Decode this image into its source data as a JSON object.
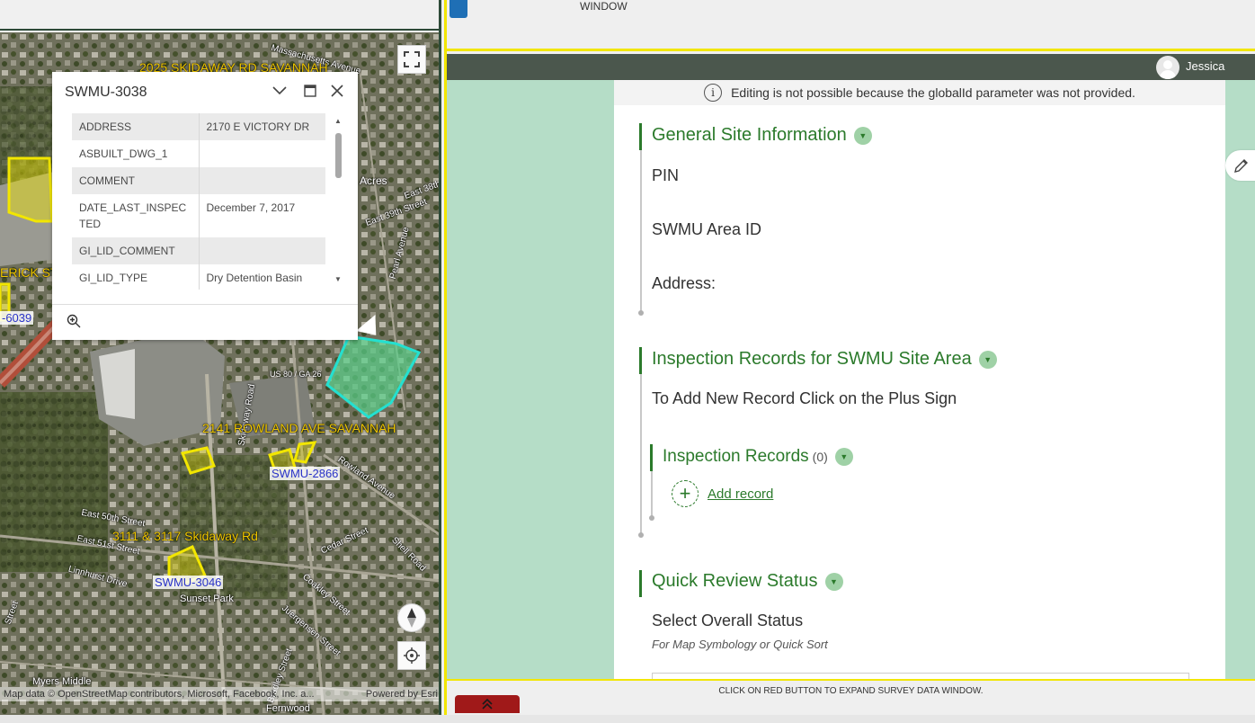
{
  "map": {
    "road_labels": [
      "Massachusetts Avenue",
      "Acres",
      "East 38th",
      "East 39th Street",
      "Pearl Avenue",
      "Rowland Avenue",
      "Skidaway Road",
      "East 50th Street",
      "East 51st Street",
      "Linnhurst Drive",
      "Cedar Street",
      "Shell Road",
      "Coakley Street",
      "Juergensen Street",
      "Bradley Street",
      "Street",
      "US 80 / GA 26"
    ],
    "address_labels": [
      "2025 SKIDAWAY RD SAVANNAH",
      "ERICK ST",
      "2141 ROWLAND AVE SAVANNAH",
      "3111 & 3117 Skidaway Rd"
    ],
    "swmu_labels": [
      "SWMU-2866",
      "SWMU-3046",
      "-6039"
    ],
    "place_labels": [
      "Sunset Park",
      "Myers Middle",
      "Fernwood"
    ],
    "attribution": "Map data © OpenStreetMap contributors, Microsoft, Facebook, Inc. a...",
    "powered_by": "Powered by Esri",
    "colors": {
      "parcel_yellow": "#f2e600",
      "selected_cyan": "#24e0d0",
      "frame": "#2d4a38"
    },
    "icons": {
      "fullscreen": "expand-icon",
      "compass": "compass-icon",
      "locate": "locate-icon"
    }
  },
  "popup": {
    "title": "SWMU-3038",
    "fields": [
      {
        "name": "ADDRESS",
        "value": "2170 E VICTORY DR"
      },
      {
        "name": "ASBUILT_DWG_1",
        "value": ""
      },
      {
        "name": "COMMENT",
        "value": ""
      },
      {
        "name": "DATE_LAST_INSPECTED",
        "value": "December 7, 2017"
      },
      {
        "name": "GI_LID_COMMENT",
        "value": ""
      },
      {
        "name": "GI_LID_TYPE",
        "value": "Dry Detention Basin"
      }
    ],
    "icons": {
      "collapse": "chevron-down-icon",
      "dock": "dock-icon",
      "close": "close-icon",
      "zoom": "zoom-to-icon"
    }
  },
  "app": {
    "window_label": "WINDOW",
    "user_name": "Jessica",
    "expand_hint": "CLICK ON RED BUTTON TO EXPAND SURVEY DATA WINDOW."
  },
  "survey": {
    "notice": "Editing is not possible because the globalId parameter was not provided.",
    "groups": {
      "general": {
        "title": "General Site Information",
        "fields": [
          "PIN",
          "SWMU Area ID",
          "Address:"
        ]
      },
      "inspection": {
        "title": "Inspection Records for SWMU Site Area",
        "note": "To Add New Record Click on the Plus Sign",
        "repeat_title": "Inspection Records",
        "repeat_count": "(0)",
        "add_label": "Add record"
      },
      "quick": {
        "title": "Quick Review Status",
        "field_label": "Select Overall Status",
        "field_hint": "For Map Symbology or Quick Sort"
      }
    },
    "colors": {
      "accent": "#2b7a2b",
      "background": "#b5ddc7",
      "header": "#4b574d",
      "expand_button": "#a01919",
      "frame_yellow": "#f2e600"
    }
  }
}
